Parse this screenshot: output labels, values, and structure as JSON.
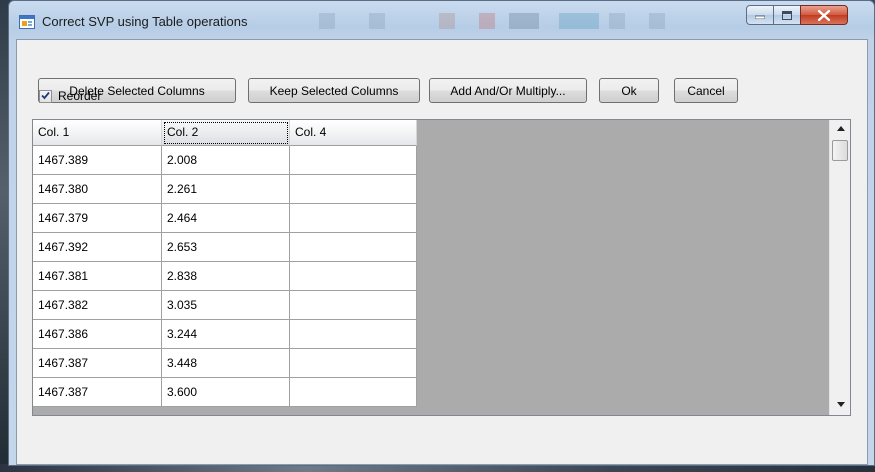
{
  "window": {
    "title": "Correct SVP using Table operations",
    "accent": "#c9dbef",
    "close_color": "#c13c20"
  },
  "toolbar": {
    "delete_label": "Delete Selected Columns",
    "keep_label": "Keep Selected Columns",
    "add_multiply_label": "Add And/Or Multiply...",
    "ok_label": "Ok",
    "cancel_label": "Cancel"
  },
  "reorder": {
    "label": "Reorder",
    "checked": true
  },
  "grid": {
    "columns": [
      "Col. 1",
      "Col. 2",
      "Col. 4"
    ],
    "selected_column": 1,
    "rows": [
      [
        "1467.389",
        "2.008",
        ""
      ],
      [
        "1467.380",
        "2.261",
        ""
      ],
      [
        "1467.379",
        "2.464",
        ""
      ],
      [
        "1467.392",
        "2.653",
        ""
      ],
      [
        "1467.381",
        "2.838",
        ""
      ],
      [
        "1467.382",
        "3.035",
        ""
      ],
      [
        "1467.386",
        "3.244",
        ""
      ],
      [
        "1467.387",
        "3.448",
        ""
      ],
      [
        "1467.387",
        "3.600",
        ""
      ]
    ],
    "background_color": "#ababab"
  },
  "icons": {
    "app": "form-window-icon",
    "minimize": "minimize-icon",
    "maximize": "maximize-icon",
    "close": "close-icon",
    "checkbox": "checkmark-icon",
    "scroll_up": "scroll-up-arrow-icon",
    "scroll_down": "scroll-down-arrow-icon"
  }
}
